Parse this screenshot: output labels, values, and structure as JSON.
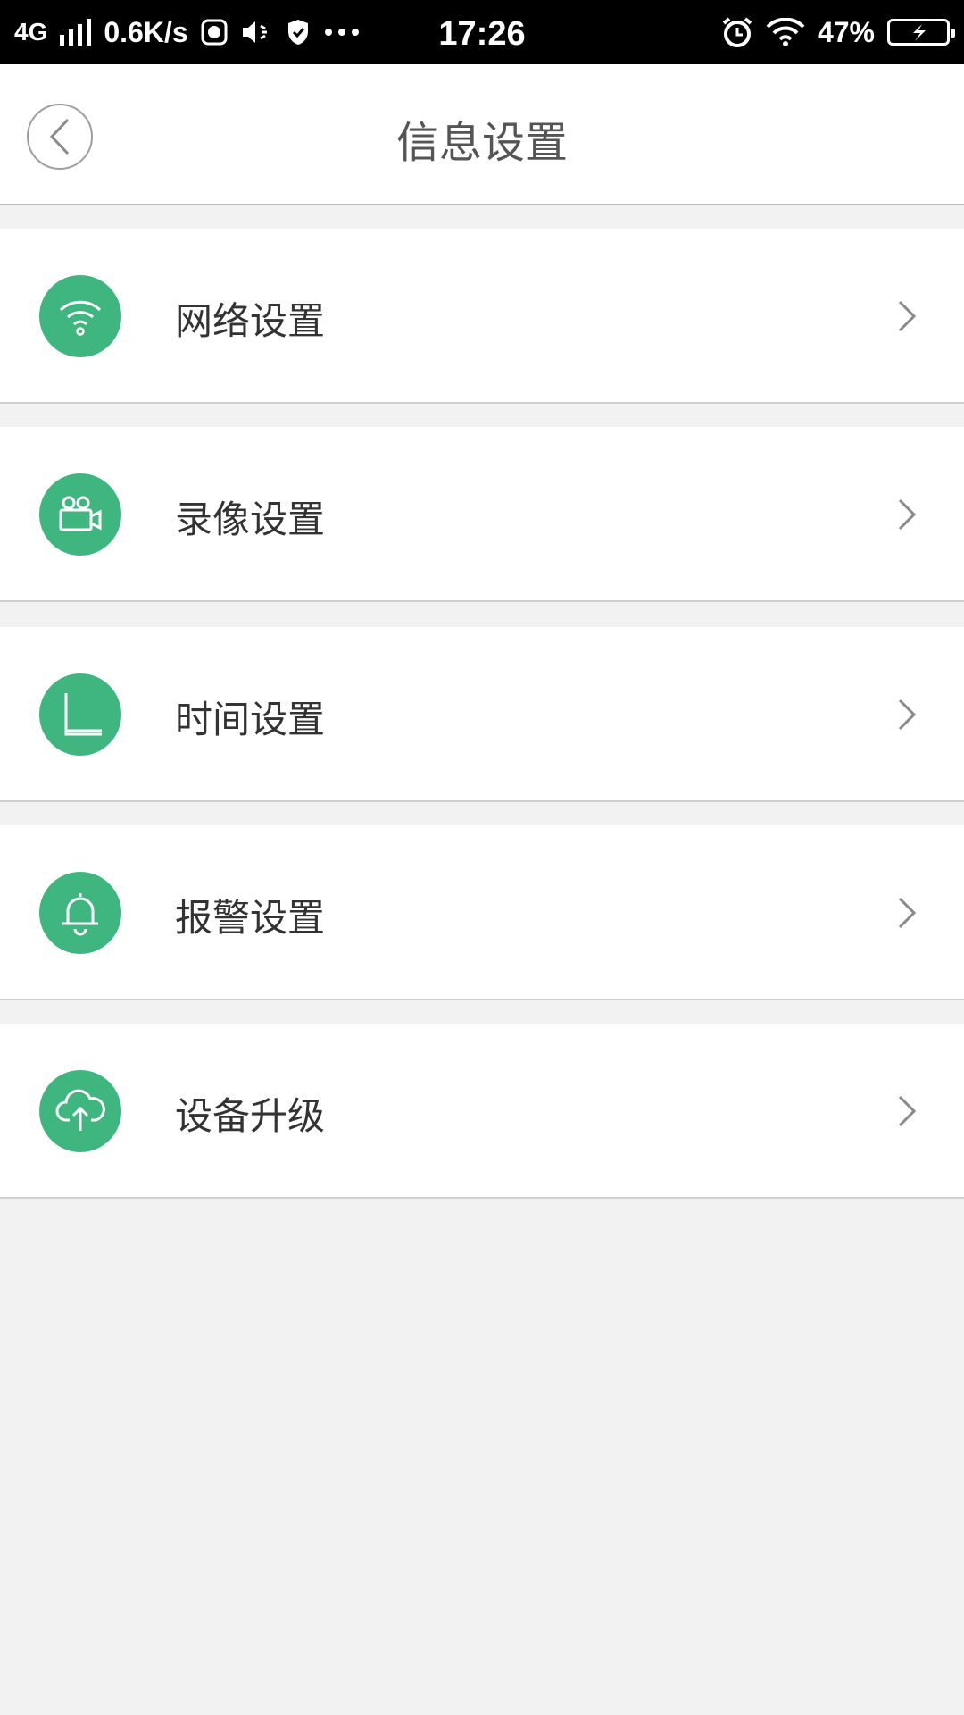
{
  "status_bar": {
    "network": "4G",
    "speed": "0.6K/s",
    "time": "17:26",
    "battery": "47%"
  },
  "header": {
    "title": "信息设置"
  },
  "menu": {
    "items": [
      {
        "label": "网络设置",
        "icon": "wifi-icon"
      },
      {
        "label": "录像设置",
        "icon": "video-camera-icon"
      },
      {
        "label": "时间设置",
        "icon": "clock-icon"
      },
      {
        "label": "报警设置",
        "icon": "bell-icon"
      },
      {
        "label": "设备升级",
        "icon": "cloud-upload-icon"
      }
    ]
  },
  "colors": {
    "accent": "#3fb67f",
    "status_bar_bg": "#000000",
    "page_bg": "#f2f2f2"
  }
}
